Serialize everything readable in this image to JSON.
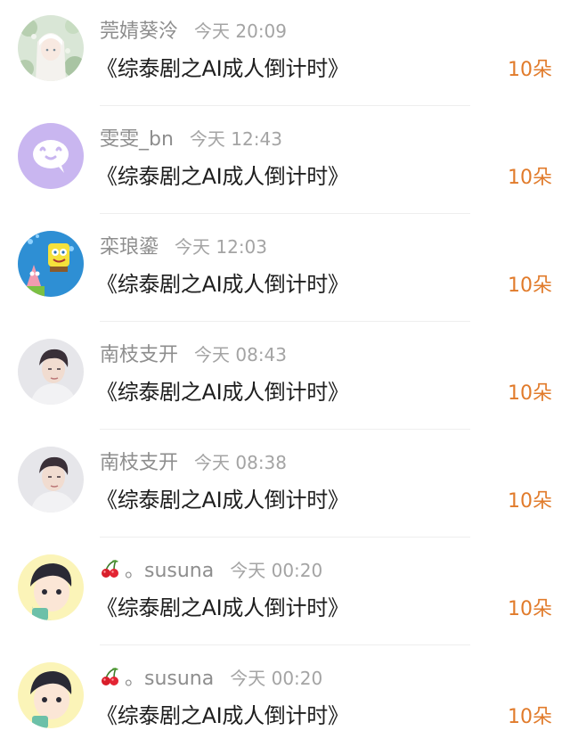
{
  "colors": {
    "name": "#8e8e8e",
    "time": "#a4a4a4",
    "title": "#1e1e1e",
    "gift": "#e17b2b",
    "divider": "#eeeeee"
  },
  "records": [
    {
      "user": "莞婧葵泠",
      "time": "今天 20:09",
      "title": "《综泰剧之AI成人倒计时》",
      "gift": "10朵",
      "avatar": "anime-girl-floral-avatar"
    },
    {
      "user": "雯雯_bn",
      "time": "今天 12:43",
      "title": "《综泰剧之AI成人倒计时》",
      "gift": "10朵",
      "avatar": "purple-chat-bubble-avatar"
    },
    {
      "user": "栾琅鎏",
      "time": "今天 12:03",
      "title": "《综泰剧之AI成人倒计时》",
      "gift": "10朵",
      "avatar": "spongebob-patrick-avatar"
    },
    {
      "user": "南枝支开",
      "time": "今天 08:43",
      "title": "《综泰剧之AI成人倒计时》",
      "gift": "10朵",
      "avatar": "man-portrait-avatar"
    },
    {
      "user": "南枝支开",
      "time": "今天 08:38",
      "title": "《综泰剧之AI成人倒计时》",
      "gift": "10朵",
      "avatar": "man-portrait-avatar"
    },
    {
      "user": "。susuna",
      "time": "今天 00:20",
      "title": "《综泰剧之AI成人倒计时》",
      "gift": "10朵",
      "avatar": "cartoon-boy-avatar",
      "name_icon": "cherry-icon"
    },
    {
      "user": "。susuna",
      "time": "今天 00:20",
      "title": "《综泰剧之AI成人倒计时》",
      "gift": "10朵",
      "avatar": "cartoon-boy-avatar",
      "name_icon": "cherry-icon"
    }
  ]
}
